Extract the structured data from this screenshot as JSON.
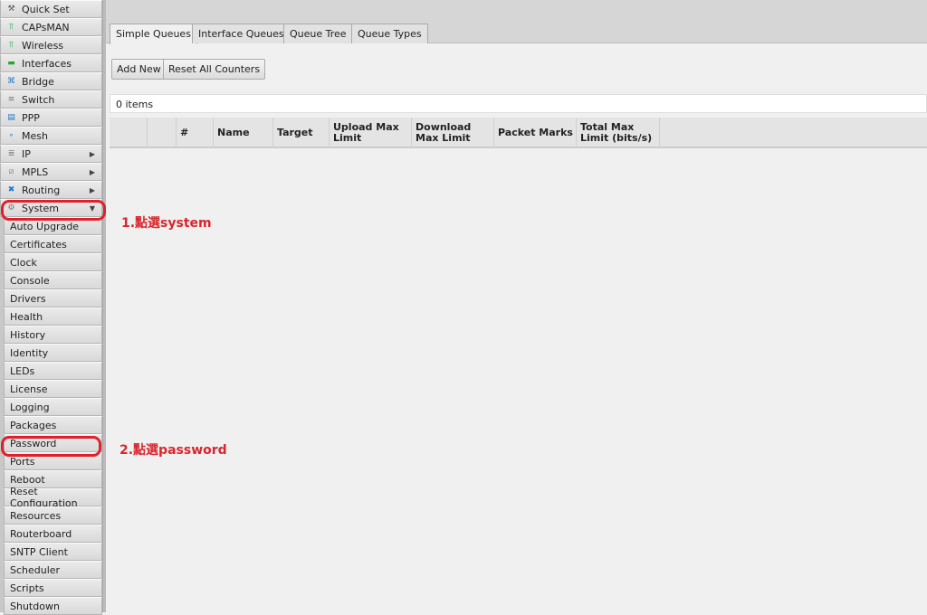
{
  "sidebar": {
    "items": [
      {
        "label": "Quick Set",
        "icon": "quick-set-icon",
        "glyph": "⚒",
        "color": "#555"
      },
      {
        "label": "CAPsMAN",
        "icon": "antenna-icon",
        "glyph": "⫪",
        "color": "#3a6"
      },
      {
        "label": "Wireless",
        "icon": "antenna-icon",
        "glyph": "⫪",
        "color": "#3a6"
      },
      {
        "label": "Interfaces",
        "icon": "interfaces-icon",
        "glyph": "▬",
        "color": "#2a2"
      },
      {
        "label": "Bridge",
        "icon": "bridge-icon",
        "glyph": "⌘",
        "color": "#27c"
      },
      {
        "label": "Switch",
        "icon": "switch-icon",
        "glyph": "≡",
        "color": "#777"
      },
      {
        "label": "PPP",
        "icon": "ppp-icon",
        "glyph": "▤",
        "color": "#27c"
      },
      {
        "label": "Mesh",
        "icon": "mesh-icon",
        "glyph": "∘",
        "color": "#27c"
      },
      {
        "label": "IP",
        "icon": "ip-icon",
        "glyph": "≣",
        "color": "#777",
        "arrow": "▶"
      },
      {
        "label": "MPLS",
        "icon": "mpls-icon",
        "glyph": "⧄",
        "color": "#888",
        "arrow": "▶"
      },
      {
        "label": "Routing",
        "icon": "routing-icon",
        "glyph": "✖",
        "color": "#27c",
        "arrow": "▶"
      },
      {
        "label": "System",
        "icon": "system-icon",
        "glyph": "⚙",
        "color": "#777",
        "arrow": "▼"
      }
    ],
    "system_sub": [
      "Auto Upgrade",
      "Certificates",
      "Clock",
      "Console",
      "Drivers",
      "Health",
      "History",
      "Identity",
      "LEDs",
      "License",
      "Logging",
      "Packages",
      "Password",
      "Ports",
      "Reboot",
      "Reset Configuration",
      "Resources",
      "Routerboard",
      "SNTP Client",
      "Scheduler",
      "Scripts",
      "Shutdown"
    ]
  },
  "tabs": [
    "Simple Queues",
    "Interface Queues",
    "Queue Tree",
    "Queue Types"
  ],
  "toolbar": {
    "add_new": "Add New",
    "reset_counters": "Reset All Counters"
  },
  "count": "0 items",
  "columns": [
    "",
    "",
    "#",
    "Name",
    "Target",
    "Upload Max Limit",
    "Download Max Limit",
    "Packet Marks",
    "Total Max Limit (bits/s)"
  ],
  "annotations": {
    "step1": "1.點選system",
    "step2": "2.點選password",
    "color": "#d9262c"
  }
}
